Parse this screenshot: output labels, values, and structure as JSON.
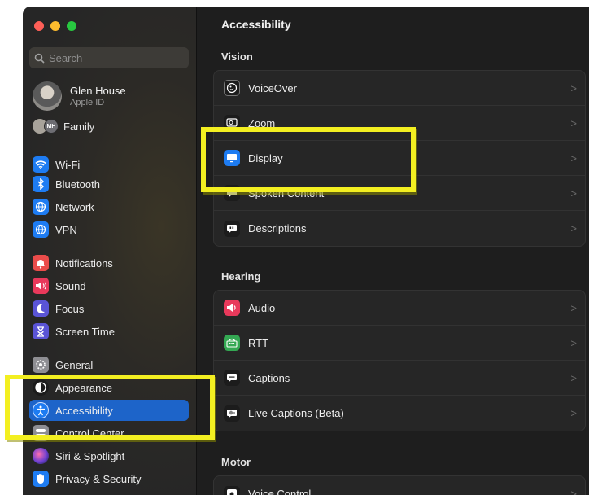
{
  "window": {
    "traffic_lights": [
      "close",
      "minimize",
      "zoom"
    ]
  },
  "search": {
    "placeholder": "Search",
    "value": ""
  },
  "profile": {
    "name": "Glen House",
    "subtitle": "Apple ID"
  },
  "family": {
    "initials": "MH",
    "label": "Family"
  },
  "sidebar": {
    "items": [
      {
        "label": "Wi-Fi",
        "icon": "wifi-icon",
        "color": "#1e7cf2"
      },
      {
        "label": "Bluetooth",
        "icon": "bluetooth-icon",
        "color": "#1e7cf2"
      },
      {
        "label": "Network",
        "icon": "globe-icon",
        "color": "#1e7cf2"
      },
      {
        "label": "VPN",
        "icon": "globe-icon",
        "color": "#1e7cf2"
      },
      {
        "label": "Notifications",
        "icon": "bell-icon",
        "color": "#ea4c4a"
      },
      {
        "label": "Sound",
        "icon": "speaker-icon",
        "color": "#e8395b"
      },
      {
        "label": "Focus",
        "icon": "moon-icon",
        "color": "#5a54d6"
      },
      {
        "label": "Screen Time",
        "icon": "hourglass-icon",
        "color": "#5a54d6"
      },
      {
        "label": "General",
        "icon": "gear-icon",
        "color": "#8e8e93"
      },
      {
        "label": "Appearance",
        "icon": "appearance-icon",
        "color": "#1c1c1c"
      },
      {
        "label": "Accessibility",
        "icon": "accessibility-icon",
        "color": "#1e7cf2",
        "active": true
      },
      {
        "label": "Control Center",
        "icon": "control-center-icon",
        "color": "#8e8e93"
      },
      {
        "label": "Siri & Spotlight",
        "icon": "siri-icon",
        "color": "#6b3fd0"
      },
      {
        "label": "Privacy & Security",
        "icon": "hand-icon",
        "color": "#1e7cf2"
      }
    ]
  },
  "main": {
    "title": "Accessibility",
    "sections": [
      {
        "title": "Vision",
        "rows": [
          {
            "label": "VoiceOver",
            "icon": "voiceover-icon",
            "color": "#1c1c1c"
          },
          {
            "label": "Zoom",
            "icon": "zoom-icon",
            "color": "#1c1c1c"
          },
          {
            "label": "Display",
            "icon": "display-icon",
            "color": "#1e7cf2"
          },
          {
            "label": "Spoken Content",
            "icon": "speech-icon",
            "color": "#1c1c1c"
          },
          {
            "label": "Descriptions",
            "icon": "quote-bubble-icon",
            "color": "#1c1c1c"
          }
        ]
      },
      {
        "title": "Hearing",
        "rows": [
          {
            "label": "Audio",
            "icon": "speaker-icon",
            "color": "#e8395b"
          },
          {
            "label": "RTT",
            "icon": "rtt-icon",
            "color": "#34a853"
          },
          {
            "label": "Captions",
            "icon": "captions-icon",
            "color": "#1c1c1c"
          },
          {
            "label": "Live Captions (Beta)",
            "icon": "live-captions-icon",
            "color": "#1c1c1c"
          }
        ]
      },
      {
        "title": "Motor",
        "rows": [
          {
            "label": "Voice Control",
            "icon": "voice-control-icon",
            "color": "#1c1c1c"
          }
        ]
      }
    ],
    "chevron": ">"
  },
  "highlight_color": "#f3ef21"
}
